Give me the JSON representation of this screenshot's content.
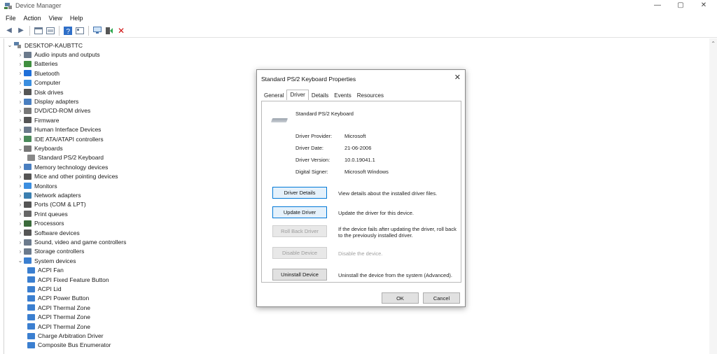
{
  "window": {
    "title": "Device Manager",
    "controls": {
      "minimize": "—",
      "maximize": "▢",
      "close": "✕"
    }
  },
  "menu": [
    "File",
    "Action",
    "View",
    "Help"
  ],
  "toolbar": {
    "icons": [
      "back-icon",
      "forward-icon",
      "show-hide-tree-icon",
      "properties-icon",
      "help-icon",
      "view-icon",
      "scan-hardware-icon",
      "update-driver-icon",
      "uninstall-icon"
    ]
  },
  "tree": {
    "root": "DESKTOP-KAUBTTC",
    "items": [
      {
        "label": "Audio inputs and outputs",
        "expanded": false,
        "color": "#6b7a8c"
      },
      {
        "label": "Batteries",
        "expanded": false,
        "color": "#3f8f3f"
      },
      {
        "label": "Bluetooth",
        "expanded": false,
        "color": "#1e6fd9"
      },
      {
        "label": "Computer",
        "expanded": false,
        "color": "#3b8ee0"
      },
      {
        "label": "Disk drives",
        "expanded": false,
        "color": "#555555"
      },
      {
        "label": "Display adapters",
        "expanded": false,
        "color": "#4a7fc0"
      },
      {
        "label": "DVD/CD-ROM drives",
        "expanded": false,
        "color": "#777777"
      },
      {
        "label": "Firmware",
        "expanded": false,
        "color": "#555555"
      },
      {
        "label": "Human Interface Devices",
        "expanded": false,
        "color": "#6b7a8c"
      },
      {
        "label": "IDE ATA/ATAPI controllers",
        "expanded": false,
        "color": "#4a8a5a"
      },
      {
        "label": "Keyboards",
        "expanded": true,
        "color": "#777777"
      },
      {
        "label": "Standard PS/2 Keyboard",
        "child": true,
        "color": "#888888"
      },
      {
        "label": "Memory technology devices",
        "expanded": false,
        "color": "#4a7fc0"
      },
      {
        "label": "Mice and other pointing devices",
        "expanded": false,
        "color": "#555555"
      },
      {
        "label": "Monitors",
        "expanded": false,
        "color": "#3b8ee0"
      },
      {
        "label": "Network adapters",
        "expanded": false,
        "color": "#3b7fb0"
      },
      {
        "label": "Ports (COM & LPT)",
        "expanded": false,
        "color": "#555555"
      },
      {
        "label": "Print queues",
        "expanded": false,
        "color": "#666666"
      },
      {
        "label": "Processors",
        "expanded": false,
        "color": "#3a6a3a"
      },
      {
        "label": "Software devices",
        "expanded": false,
        "color": "#555555"
      },
      {
        "label": "Sound, video and game controllers",
        "expanded": false,
        "color": "#6b7a8c"
      },
      {
        "label": "Storage controllers",
        "expanded": false,
        "color": "#6b7a8c"
      },
      {
        "label": "System devices",
        "expanded": true,
        "color": "#3b7fd0"
      },
      {
        "label": "ACPI Fan",
        "child": true,
        "color": "#3b7fd0"
      },
      {
        "label": "ACPI Fixed Feature Button",
        "child": true,
        "color": "#3b7fd0"
      },
      {
        "label": "ACPI Lid",
        "child": true,
        "color": "#3b7fd0"
      },
      {
        "label": "ACPI Power Button",
        "child": true,
        "color": "#3b7fd0"
      },
      {
        "label": "ACPI Thermal Zone",
        "child": true,
        "color": "#3b7fd0"
      },
      {
        "label": "ACPI Thermal Zone",
        "child": true,
        "color": "#3b7fd0"
      },
      {
        "label": "ACPI Thermal Zone",
        "child": true,
        "color": "#3b7fd0"
      },
      {
        "label": "Charge Arbitration Driver",
        "child": true,
        "color": "#3b7fd0"
      },
      {
        "label": "Composite Bus Enumerator",
        "child": true,
        "color": "#3b7fd0"
      }
    ]
  },
  "dialog": {
    "title": "Standard PS/2 Keyboard Properties",
    "close": "✕",
    "tabs": [
      "General",
      "Driver",
      "Details",
      "Events",
      "Resources"
    ],
    "active_tab": "Driver",
    "device_name": "Standard PS/2 Keyboard",
    "info": {
      "provider_label": "Driver Provider:",
      "provider": "Microsoft",
      "date_label": "Driver Date:",
      "date": "21-06-2006",
      "version_label": "Driver Version:",
      "version": "10.0.19041.1",
      "signer_label": "Digital Signer:",
      "signer": "Microsoft Windows"
    },
    "buttons": {
      "details": "Driver Details",
      "details_desc": "View details about the installed driver files.",
      "update": "Update Driver",
      "update_desc": "Update the driver for this device.",
      "rollback": "Roll Back Driver",
      "rollback_desc": "If the device fails after updating the driver, roll back to the previously installed driver.",
      "disable": "Disable Device",
      "disable_desc": "Disable the device.",
      "uninstall": "Uninstall Device",
      "uninstall_desc": "Uninstall the device from the system (Advanced).",
      "ok": "OK",
      "cancel": "Cancel"
    }
  }
}
